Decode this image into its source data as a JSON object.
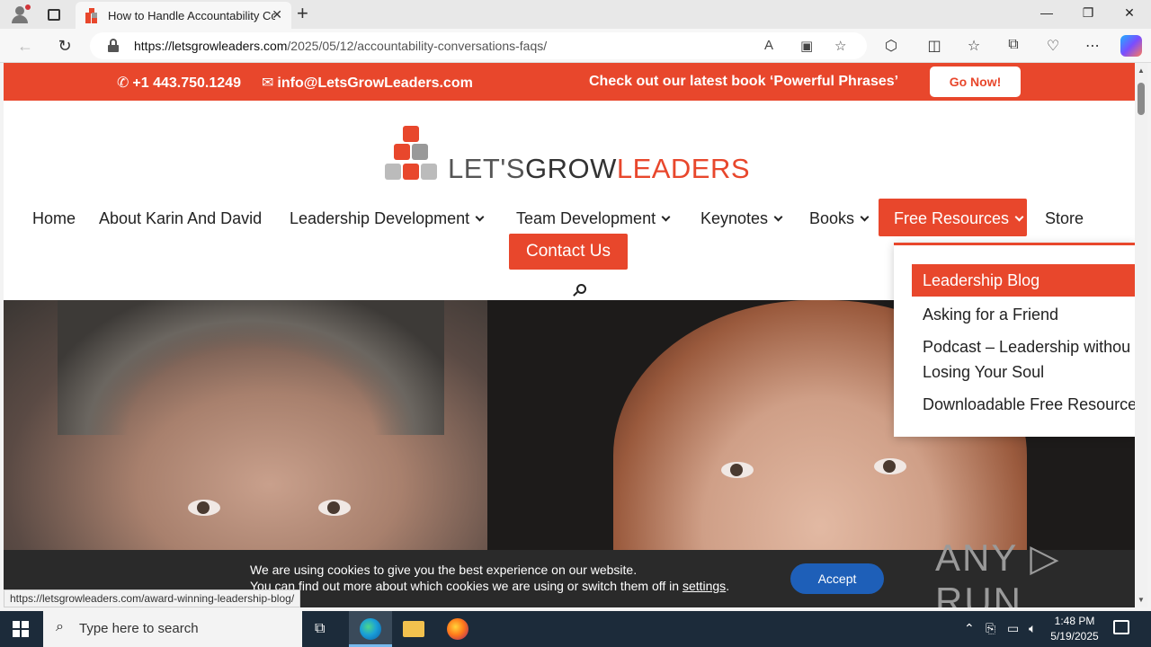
{
  "browser": {
    "tab_title": "How to Handle Accountability Co",
    "tab_close": "✕",
    "new_tab": "+",
    "url_domain": "https://letsgrowleaders.com",
    "url_path": "/2025/05/12/accountability-conversations-faqs/",
    "status_url": "https://letsgrowleaders.com/award-winning-leadership-blog/"
  },
  "topbar": {
    "phone": "+1 443.750.1249",
    "email": "info@LetsGrowLeaders.com",
    "promo": "Check out our latest book ‘Powerful Phrases’",
    "cta": "Go Now!"
  },
  "logo": {
    "part1": "LET'S",
    "part2": "GROW",
    "part3": "LEADERS"
  },
  "menu": {
    "items": [
      "Home",
      "About Karin And David",
      "Leadership Development",
      "Team Development",
      "Keynotes",
      "Books",
      "Free Resources",
      "Store"
    ],
    "contact": "Contact Us"
  },
  "dropdown": {
    "items": [
      "Leadership Blog",
      "Asking for a Friend",
      "Podcast – Leadership withou",
      "Losing Your Soul",
      "Downloadable Free Resource"
    ]
  },
  "cookie": {
    "line1": "We are using cookies to give you the best experience on our website.",
    "line2_prefix": "You can find out more about which cookies we are using or switch them off in",
    "settings": "settings",
    "line2_suffix": ".",
    "accept": "Accept",
    "watermark": "ANY ▷ RUN"
  },
  "taskbar": {
    "search_placeholder": "Type here to search",
    "time": "1:48 PM",
    "date": "5/19/2025"
  },
  "colors": {
    "brand": "#e8472c",
    "accept": "#1e5fb8",
    "taskbar": "#1c2b3a"
  }
}
